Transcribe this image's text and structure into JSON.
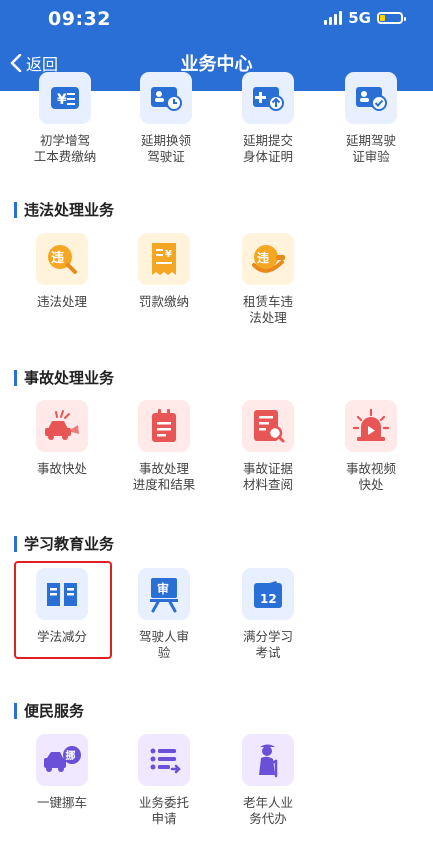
{
  "status_bar": {
    "time": "09:32",
    "network": "5G",
    "battery_level": 0.25
  },
  "header": {
    "back_label": "返回",
    "title": "业务中心"
  },
  "top_row": [
    {
      "label": "初学增驾工本费缴纳",
      "icon": "payment-yen-icon"
    },
    {
      "label": "延期换领驾驶证",
      "icon": "renew-license-clock-icon"
    },
    {
      "label": "延期提交身体证明",
      "icon": "medical-upload-icon"
    },
    {
      "label": "延期驾驶证审验",
      "icon": "license-check-icon"
    }
  ],
  "sections": [
    {
      "title": "违法处理业务",
      "items": [
        {
          "label": "违法处理",
          "icon": "violation-search-icon"
        },
        {
          "label": "罚款缴纳",
          "icon": "fine-receipt-icon"
        },
        {
          "label": "租赁车违法处理",
          "icon": "rental-violation-icon"
        }
      ]
    },
    {
      "title": "事故处理业务",
      "items": [
        {
          "label": "事故快处",
          "icon": "accident-car-icon"
        },
        {
          "label": "事故处理进度和结果",
          "icon": "clipboard-progress-icon"
        },
        {
          "label": "事故证据材料查阅",
          "icon": "document-search-icon"
        },
        {
          "label": "事故视频快处",
          "icon": "siren-video-icon"
        }
      ]
    },
    {
      "title": "学习教育业务",
      "items": [
        {
          "label": "学法减分",
          "icon": "book-icon"
        },
        {
          "label": "驾驶人审验",
          "icon": "review-board-icon"
        },
        {
          "label": "满分学习考试",
          "icon": "calendar-12-icon"
        }
      ]
    },
    {
      "title": "便民服务",
      "items": [
        {
          "label": "一键挪车",
          "icon": "move-truck-icon"
        },
        {
          "label": "业务委托申请",
          "icon": "delegate-list-icon"
        },
        {
          "label": "老年人业务代办",
          "icon": "elderly-icon"
        }
      ]
    }
  ],
  "colors": {
    "header": "#2a6fd6",
    "highlight": "#e02020",
    "blue_icon": "#2a6fd6",
    "orange_icon": "#f5a623",
    "red_icon": "#e85555",
    "purple_icon": "#6a4fd8"
  }
}
